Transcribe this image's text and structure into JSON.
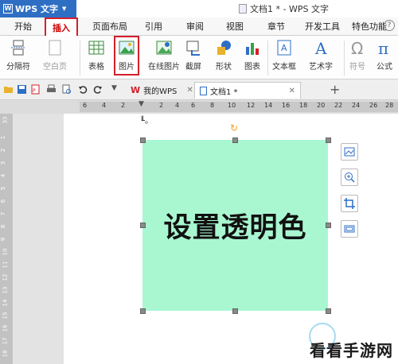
{
  "titlebar": {
    "app_name": "WPS 文字",
    "logo_letter": "W",
    "doc_title": "文档1 * - WPS 文字"
  },
  "tabs": [
    "开始",
    "插入",
    "页面布局",
    "引用",
    "审阅",
    "视图",
    "章节",
    "开发工具",
    "特色功能"
  ],
  "active_tab": "插入",
  "ribbon": {
    "page_break": "分隔符",
    "blank_page": "空白页",
    "table": "表格",
    "picture": "图片",
    "online_picture": "在线图片",
    "screenshot": "截屏",
    "shapes": "形状",
    "chart": "图表",
    "textbox": "文本框",
    "wordart": "艺术字",
    "symbol": "符号",
    "formula": "公式"
  },
  "doc_tabs": {
    "home_tab": "我的WPS",
    "doc_tab": "文档1 *"
  },
  "ruler": {
    "h_ticks": [
      "6",
      "4",
      "2",
      "2",
      "4",
      "6",
      "8",
      "10",
      "12",
      "14",
      "16",
      "18",
      "20",
      "22",
      "24",
      "26",
      "28"
    ],
    "v_ticks": [
      "33",
      "1",
      "2",
      "3",
      "4",
      "5",
      "6",
      "7",
      "8",
      "9",
      "10",
      "11",
      "12",
      "13",
      "14",
      "15",
      "16",
      "17",
      "18"
    ]
  },
  "document": {
    "cursor_text": "╙。",
    "image_text": "设置透明色"
  },
  "watermark": "看看手游网",
  "colors": {
    "accent": "#d3202b",
    "titlebar_blue": "#2e6fc4",
    "image_fill": "#a9f7d1"
  }
}
